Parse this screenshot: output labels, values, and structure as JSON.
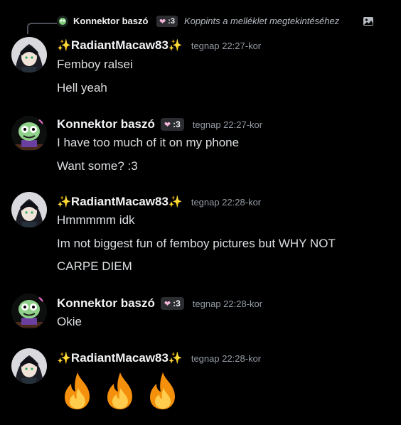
{
  "reply": {
    "author": "Konnektor baszó",
    "tag": ":3",
    "text": "Koppints a melléklet megtekintéséhez"
  },
  "messages": [
    {
      "author": "RadiantMacaw83",
      "sparkle_left": "✨",
      "sparkle_right": "✨",
      "time": "tegnap 22:27-kor",
      "lines": [
        "Femboy ralsei",
        "Hell yeah"
      ]
    },
    {
      "author": "Konnektor baszó",
      "tag": ":3",
      "time": "tegnap 22:27-kor",
      "lines": [
        "I have too much of it on my phone",
        "Want some? :3"
      ]
    },
    {
      "author": "RadiantMacaw83",
      "sparkle_left": "✨",
      "sparkle_right": "✨",
      "time": "tegnap 22:28-kor",
      "lines": [
        "Hmmmmm idk",
        "Im not biggest fun of femboy pictures but WHY NOT",
        "CARPE DIEM"
      ]
    },
    {
      "author": "Konnektor baszó",
      "tag": ":3",
      "time": "tegnap 22:28-kor",
      "lines": [
        "Okie"
      ]
    },
    {
      "author": "RadiantMacaw83",
      "sparkle_left": "✨",
      "sparkle_right": "✨",
      "time": "tegnap 22:28-kor",
      "emoji": [
        "fire-emoji",
        "fire-emoji",
        "fire-emoji"
      ]
    }
  ],
  "colors": {
    "background": "#000000",
    "text": "#dbdee1",
    "username": "#f2f3f5",
    "timestamp": "#949ba4",
    "tag_bg": "#2b2d31"
  }
}
